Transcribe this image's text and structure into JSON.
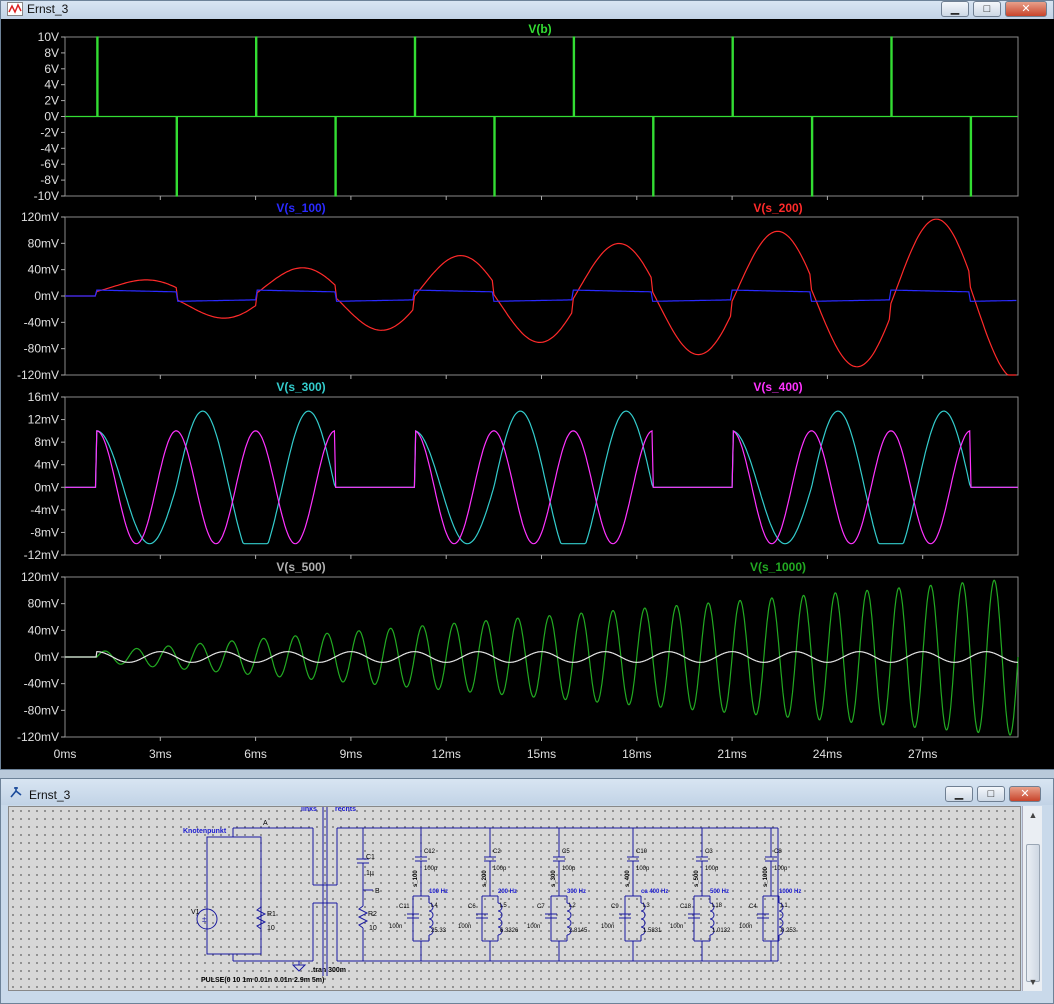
{
  "plot_window": {
    "title": "Ernst_3",
    "buttons": {
      "minimize": "▁",
      "maximize": "□",
      "close": "✕"
    }
  },
  "schematic_window": {
    "title": "Ernst_3",
    "buttons": {
      "minimize": "▁",
      "maximize": "□",
      "close": "✕"
    },
    "labels": {
      "knotenpunkt": "Knotenpunkt",
      "a": "A",
      "links": "links",
      "rechts": "rechts",
      "b": "B",
      "v1": "V1",
      "r1": "R1",
      "r1_val": "10",
      "r2": "R2",
      "r2_val": "10",
      "c1": "C1",
      "c1_val": "1µ",
      "tran": ".tran 300m",
      "pulse": "PULSE(0 10 1m 0.01n 0.01n 2.9m 5m)"
    },
    "filters": [
      {
        "cap_top": "C12",
        "cap_top_val": "100p",
        "net": "s_100",
        "freq": "100 Hz",
        "cap": "C11",
        "cap_val": "100n",
        "ind": "L4",
        "ind_val": "25.33"
      },
      {
        "cap_top": "C2",
        "cap_top_val": "100p",
        "net": "s_200",
        "freq": "200 Hz",
        "cap": "C6",
        "cap_val": "100n",
        "ind": "L5",
        "ind_val": "6.3326"
      },
      {
        "cap_top": "C5",
        "cap_top_val": "100p",
        "net": "s_300",
        "freq": "300 Hz",
        "cap": "C7",
        "cap_val": "100n",
        "ind": "L2",
        "ind_val": "2.8145"
      },
      {
        "cap_top": "C10",
        "cap_top_val": "100p",
        "net": "s_400",
        "freq": "ca 400 Hz",
        "cap": "C9",
        "cap_val": "100n",
        "ind": "L3",
        "ind_val": "1.5831"
      },
      {
        "cap_top": "C3",
        "cap_top_val": "100p",
        "net": "s_500",
        "freq": "500 Hz",
        "cap": "C18",
        "cap_val": "100n",
        "ind": "L18",
        "ind_val": "1.0132"
      },
      {
        "cap_top": "C8",
        "cap_top_val": "100p",
        "net": "s_1000",
        "freq": "1000 Hz",
        "cap": "C4",
        "cap_val": "100n",
        "ind": "L1",
        "ind_val": "0.253"
      }
    ]
  },
  "chart_data": [
    {
      "type": "line",
      "series": [
        {
          "name": "V(b)",
          "color": "#33dd33"
        }
      ],
      "ylim": [
        -10,
        10
      ],
      "yticks": [
        "10V",
        "8V",
        "6V",
        "4V",
        "2V",
        "0V",
        "-2V",
        "-4V",
        "-6V",
        "-8V",
        "-10V"
      ],
      "xlim": [
        0,
        30
      ],
      "pulse_high_ms": [
        1.0,
        6.0,
        11.0,
        16.0,
        21.0,
        26.0
      ],
      "pulse_low_ms": [
        3.5,
        8.5,
        13.5,
        18.5,
        23.5,
        28.5
      ]
    },
    {
      "type": "line",
      "series": [
        {
          "name": "V(s_100)",
          "color": "#2a2aff"
        },
        {
          "name": "V(s_200)",
          "color": "#ff2a2a"
        }
      ],
      "ylim": [
        -120,
        120
      ],
      "yticks": [
        "120mV",
        "80mV",
        "40mV",
        "0mV",
        "-40mV",
        "-80mV",
        "-120mV"
      ],
      "xlim": [
        0,
        30
      ],
      "s_100_amplitude_mV": 10,
      "s_200_peaks_mV": [
        27,
        48,
        68,
        88,
        108,
        118
      ]
    },
    {
      "type": "line",
      "series": [
        {
          "name": "V(s_300)",
          "color": "#33cccc"
        },
        {
          "name": "V(s_400)",
          "color": "#ff33ff"
        }
      ],
      "ylim": [
        -12,
        16
      ],
      "yticks": [
        "16mV",
        "12mV",
        "8mV",
        "4mV",
        "0mV",
        "-4mV",
        "-8mV",
        "-12mV"
      ],
      "xlim": [
        0,
        30
      ],
      "s_300_peak_mV": 14,
      "s_400_peak_mV": 10
    },
    {
      "type": "line",
      "series": [
        {
          "name": "V(s_500)",
          "color": "#e6e6e6"
        },
        {
          "name": "V(s_1000)",
          "color": "#22aa22"
        }
      ],
      "ylim": [
        -120,
        120
      ],
      "yticks": [
        "120mV",
        "80mV",
        "40mV",
        "0mV",
        "-40mV",
        "-80mV",
        "-120mV"
      ],
      "xlim": [
        0,
        30
      ],
      "xticks": [
        "0ms",
        "3ms",
        "6ms",
        "9ms",
        "12ms",
        "15ms",
        "18ms",
        "21ms",
        "24ms",
        "27ms"
      ],
      "s_500_amplitude_mV": 8,
      "s_1000_max_mV": 118
    }
  ]
}
